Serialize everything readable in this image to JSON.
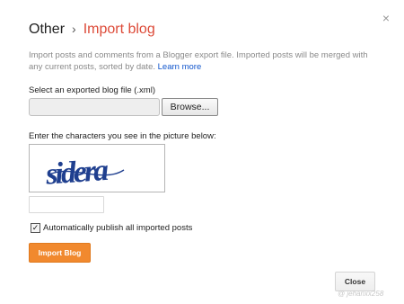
{
  "dialog": {
    "close_glyph": "×",
    "title": {
      "parent": "Other",
      "separator": "›",
      "current": "Import blog",
      "current_color": "#dd4b39"
    },
    "description": "Import posts and comments from a Blogger export file. Imported posts will be merged with any current posts, sorted by date.",
    "learn_more": "Learn more",
    "link_color": "#1155cc"
  },
  "file_section": {
    "label": "Select an exported blog file (.xml)",
    "file_value": "",
    "browse_label": "Browse..."
  },
  "captcha_section": {
    "label": "Enter the characters you see in the picture below:",
    "captcha_text": "sidera",
    "input_value": ""
  },
  "auto_publish": {
    "checked": true,
    "label": "Automatically publish all imported posts"
  },
  "buttons": {
    "import_label": "Import Blog",
    "import_color": "#f1892e",
    "close_label": "Close"
  },
  "watermark": {
    "text": "@ jehanxx258"
  }
}
